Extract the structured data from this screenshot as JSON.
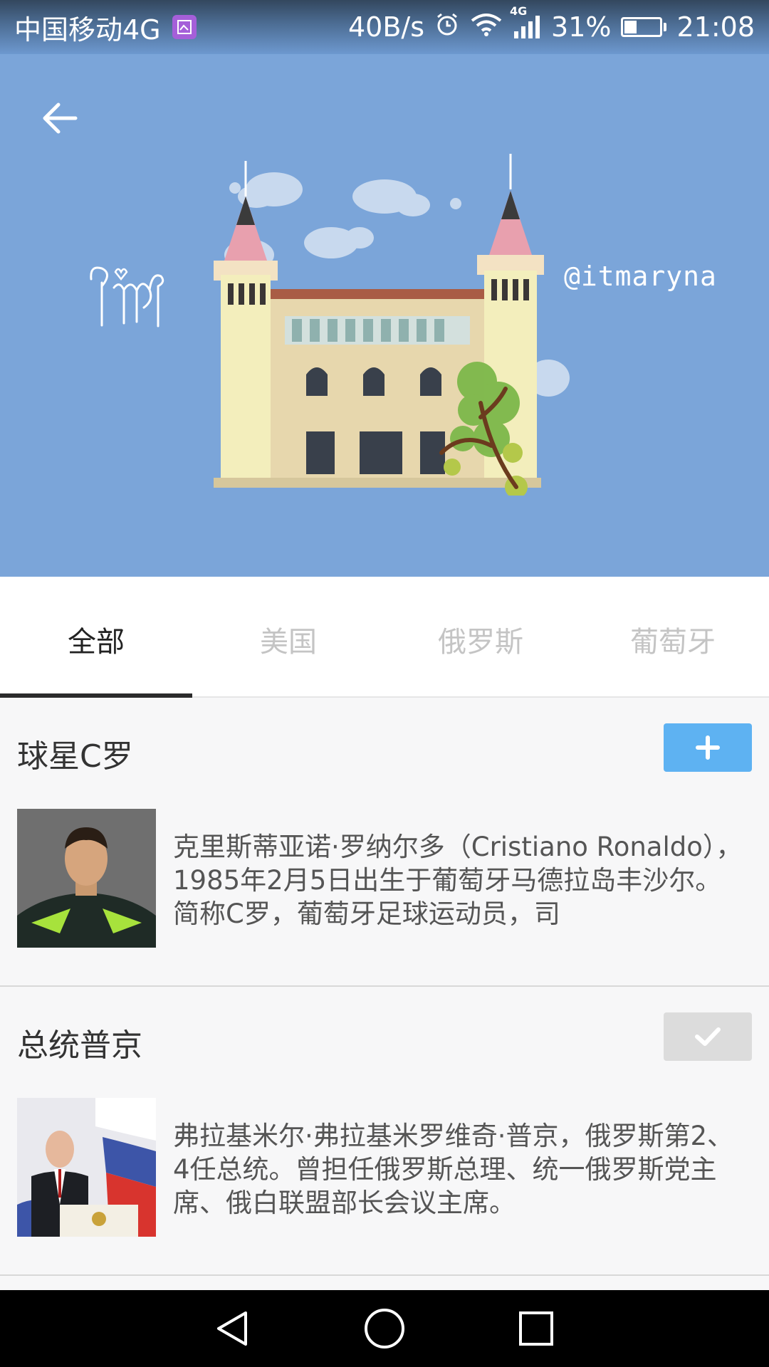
{
  "status_bar": {
    "carrier": "中国移动4G",
    "speed": "40B/s",
    "network": "4G",
    "battery_percent": "31%",
    "battery_level": 0.31,
    "time": "21:08"
  },
  "header": {
    "handle": "@itmaryna"
  },
  "tabs": [
    {
      "label": "全部",
      "active": true
    },
    {
      "label": "美国",
      "active": false
    },
    {
      "label": "俄罗斯",
      "active": false
    },
    {
      "label": "葡萄牙",
      "active": false
    }
  ],
  "items": [
    {
      "title": "球星C罗",
      "button_state": "add",
      "description": "克里斯蒂亚诺·罗纳尔多（Cristiano Ronaldo），1985年2月5日出生于葡萄牙马德拉岛丰沙尔。简称C罗，葡萄牙足球运动员，司"
    },
    {
      "title": "总统普京",
      "button_state": "followed",
      "description": "弗拉基米尔·弗拉基米罗维奇·普京，俄罗斯第2、4任总统。曾担任俄罗斯总理、统一俄罗斯党主席、俄白联盟部长会议主席。"
    }
  ],
  "colors": {
    "banner": "#7ba5d9",
    "add_button": "#5eb2f2",
    "followed_button": "#dcdcdc",
    "active_tab": "#222222",
    "inactive_tab": "#c4c4c4"
  },
  "icons": {
    "back": "arrow-left-icon",
    "alarm": "alarm-icon",
    "wifi": "wifi-icon",
    "signal": "signal-icon",
    "battery": "battery-icon",
    "gallery": "gallery-icon",
    "add": "plus-icon",
    "followed": "check-icon",
    "nav_back": "triangle-back-icon",
    "nav_home": "circle-home-icon",
    "nav_recent": "square-recent-icon"
  }
}
